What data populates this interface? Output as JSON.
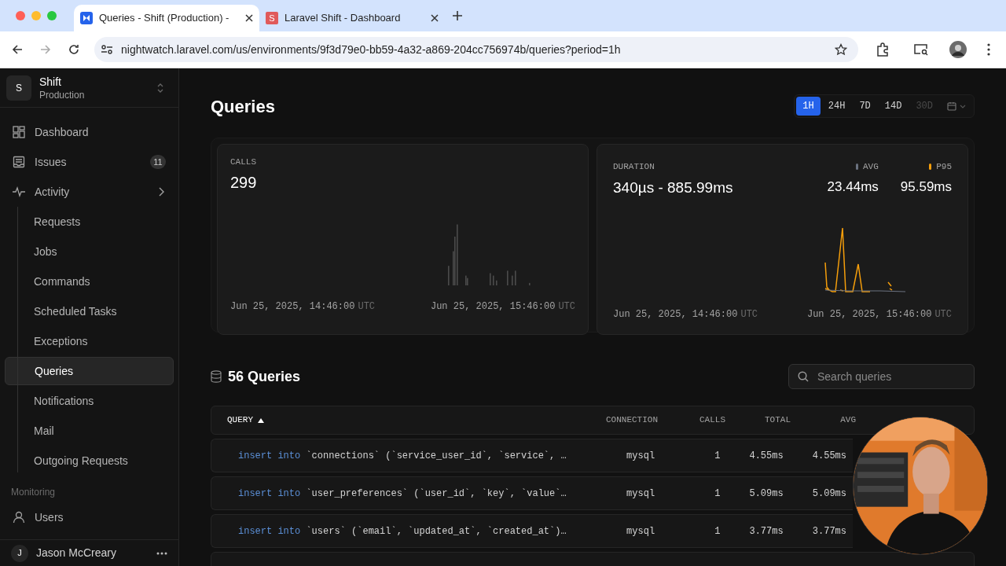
{
  "browser": {
    "tabs": [
      {
        "title": "Queries - Shift (Production) -",
        "selected": true,
        "color": "#2563eb"
      },
      {
        "title": "Laravel Shift - Dashboard",
        "selected": false,
        "letter": "S",
        "color": "#e05a5a"
      }
    ],
    "url": "nightwatch.laravel.com/us/environments/9f3d79e0-bb59-4a32-a869-204cc756974b/queries?period=1h"
  },
  "sidebar": {
    "org": {
      "initial": "S",
      "name": "Shift",
      "environment": "Production"
    },
    "items": [
      {
        "label": "Dashboard",
        "selected": false
      },
      {
        "label": "Issues",
        "badge": "11",
        "selected": false
      },
      {
        "label": "Activity",
        "selected": false,
        "children": [
          {
            "label": "Requests",
            "selected": false
          },
          {
            "label": "Jobs",
            "selected": false
          },
          {
            "label": "Commands",
            "selected": false
          },
          {
            "label": "Scheduled Tasks",
            "selected": false
          },
          {
            "label": "Exceptions",
            "selected": false
          },
          {
            "label": "Queries",
            "selected": true
          },
          {
            "label": "Notifications",
            "selected": false
          },
          {
            "label": "Mail",
            "selected": false
          },
          {
            "label": "Outgoing Requests",
            "selected": false
          }
        ]
      }
    ],
    "section": "Monitoring",
    "section_items": [
      {
        "label": "Users",
        "selected": false
      }
    ],
    "user": {
      "initial": "J",
      "name": "Jason McCreary"
    }
  },
  "main": {
    "title": "Queries",
    "periods": [
      {
        "label": "1H",
        "selected": true,
        "disabled": false
      },
      {
        "label": "24H",
        "selected": false,
        "disabled": false
      },
      {
        "label": "7D",
        "selected": false,
        "disabled": false
      },
      {
        "label": "14D",
        "selected": false,
        "disabled": false
      },
      {
        "label": "30D",
        "selected": false,
        "disabled": true
      }
    ],
    "calls": {
      "label": "CALLS",
      "value": "299",
      "start": {
        "time": "Jun 25, 2025, 14:46:00",
        "tz": "UTC"
      },
      "end": {
        "time": "Jun 25, 2025, 15:46:00",
        "tz": "UTC"
      }
    },
    "duration": {
      "label": "DURATION",
      "value": "340µs - 885.99ms",
      "legend": [
        {
          "label": "AVG",
          "value": "23.44ms",
          "color": "#6b7280"
        },
        {
          "label": "P95",
          "value": "95.59ms",
          "color": "#f59e0b"
        }
      ],
      "start": {
        "time": "Jun 25, 2025, 14:46:00",
        "tz": "UTC"
      },
      "end": {
        "time": "Jun 25, 2025, 15:46:00",
        "tz": "UTC"
      }
    },
    "table": {
      "title": "56 Queries",
      "search": {
        "placeholder": "Search queries"
      },
      "columns": [
        {
          "label": "QUERY",
          "sorted": true
        },
        {
          "label": "CONNECTION",
          "sorted": false
        },
        {
          "label": "CALLS",
          "sorted": false
        },
        {
          "label": "TOTAL",
          "sorted": false
        },
        {
          "label": "AVG",
          "sorted": false
        }
      ],
      "rows": [
        {
          "keyword": "insert into",
          "text": "`connections` (`service_user_id`, `service`, …",
          "connection": "mysql",
          "calls": "1",
          "total": "4.55ms",
          "avg": "4.55ms"
        },
        {
          "keyword": "insert into",
          "text": "`user_preferences` (`user_id`, `key`, `value`…",
          "connection": "mysql",
          "calls": "1",
          "total": "5.09ms",
          "avg": "5.09ms"
        },
        {
          "keyword": "insert into",
          "text": "`users` (`email`, `updated_at`, `created_at`)…",
          "connection": "mysql",
          "calls": "1",
          "total": "3.77ms",
          "avg": "3.77ms"
        }
      ]
    }
  }
}
